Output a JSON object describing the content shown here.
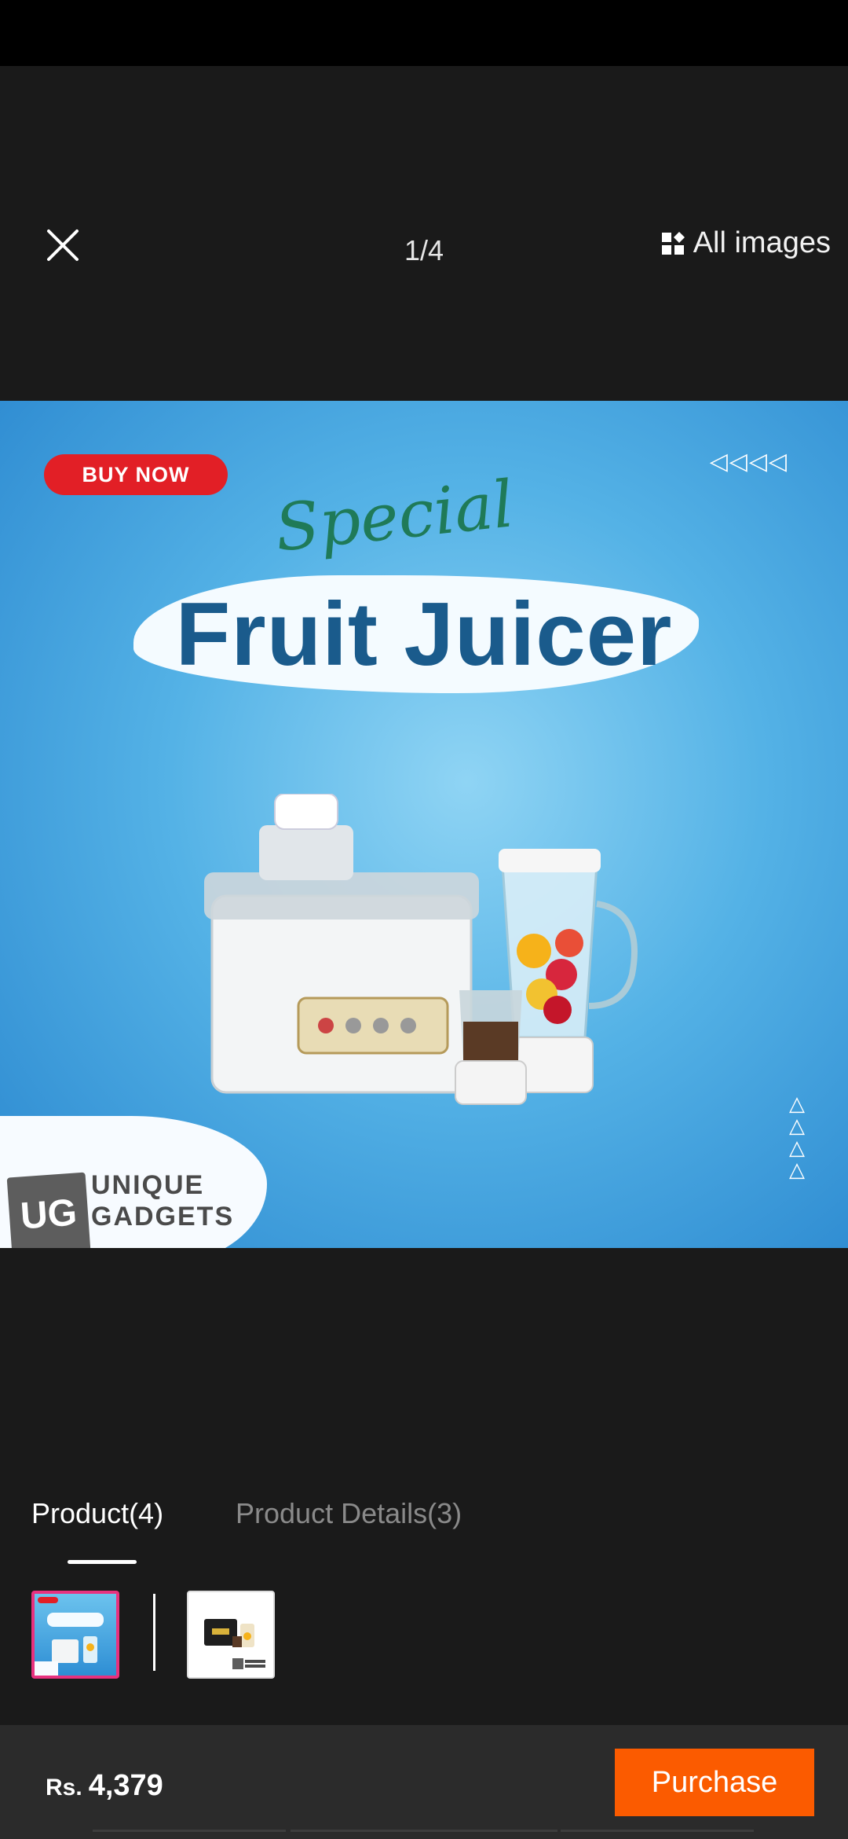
{
  "header": {
    "counter": "1/4",
    "all_images_label": "All images"
  },
  "hero": {
    "badge": "BUY NOW",
    "script_text": "Special",
    "title": "Fruit Juicer",
    "arrows_top": "◁◁◁◁",
    "arrows_side": [
      "△",
      "△",
      "△",
      "△"
    ],
    "logo_badge": "UG",
    "logo_line1": "UNIQUE",
    "logo_line2": "GADGETS"
  },
  "tabs": [
    {
      "label": "Product(4)",
      "active": true
    },
    {
      "label": "Product Details(3)",
      "active": false
    }
  ],
  "thumbnails": {
    "thumb1_title": "Fruit Juicer",
    "thumb1_script": "Special"
  },
  "footer": {
    "currency": "Rs.",
    "price": "4,379",
    "purchase_label": "Purchase"
  },
  "colors": {
    "accent": "#fb5b00",
    "thumb_selected_border": "#e8327f",
    "background": "#1a1a1a"
  },
  "icons": [
    "close-icon",
    "grid-icon"
  ]
}
